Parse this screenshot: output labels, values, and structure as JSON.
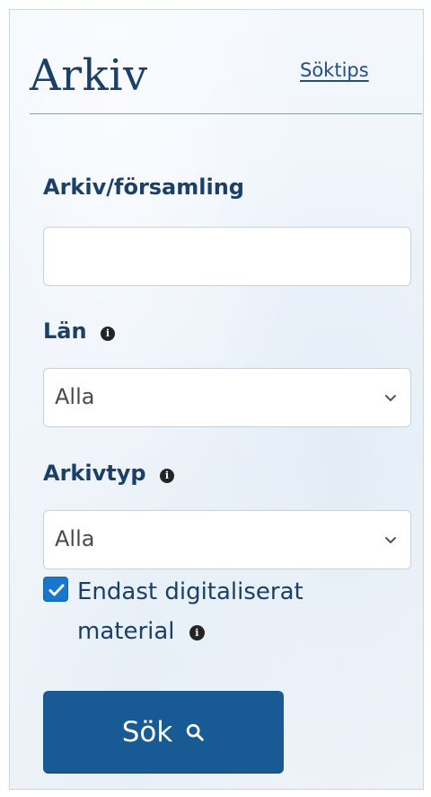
{
  "panel": {
    "title": "Arkiv",
    "help_link": "Söktips"
  },
  "fields": {
    "archive_parish": {
      "label": "Arkiv/församling",
      "value": "",
      "placeholder": ""
    },
    "county": {
      "label": "Län",
      "value": "Alla",
      "icon": "info-icon"
    },
    "archive_type": {
      "label": "Arkivtyp",
      "value": "Alla",
      "icon": "info-icon"
    }
  },
  "checkbox": {
    "label_line1": "Endast digitaliserat",
    "label_line2": "material",
    "checked": true,
    "icon": "info-icon"
  },
  "search": {
    "label": "Sök",
    "icon": "search-icon"
  },
  "colors": {
    "accent": "#1677cc",
    "primary_text": "#1a3f68",
    "button": "#185a93"
  }
}
